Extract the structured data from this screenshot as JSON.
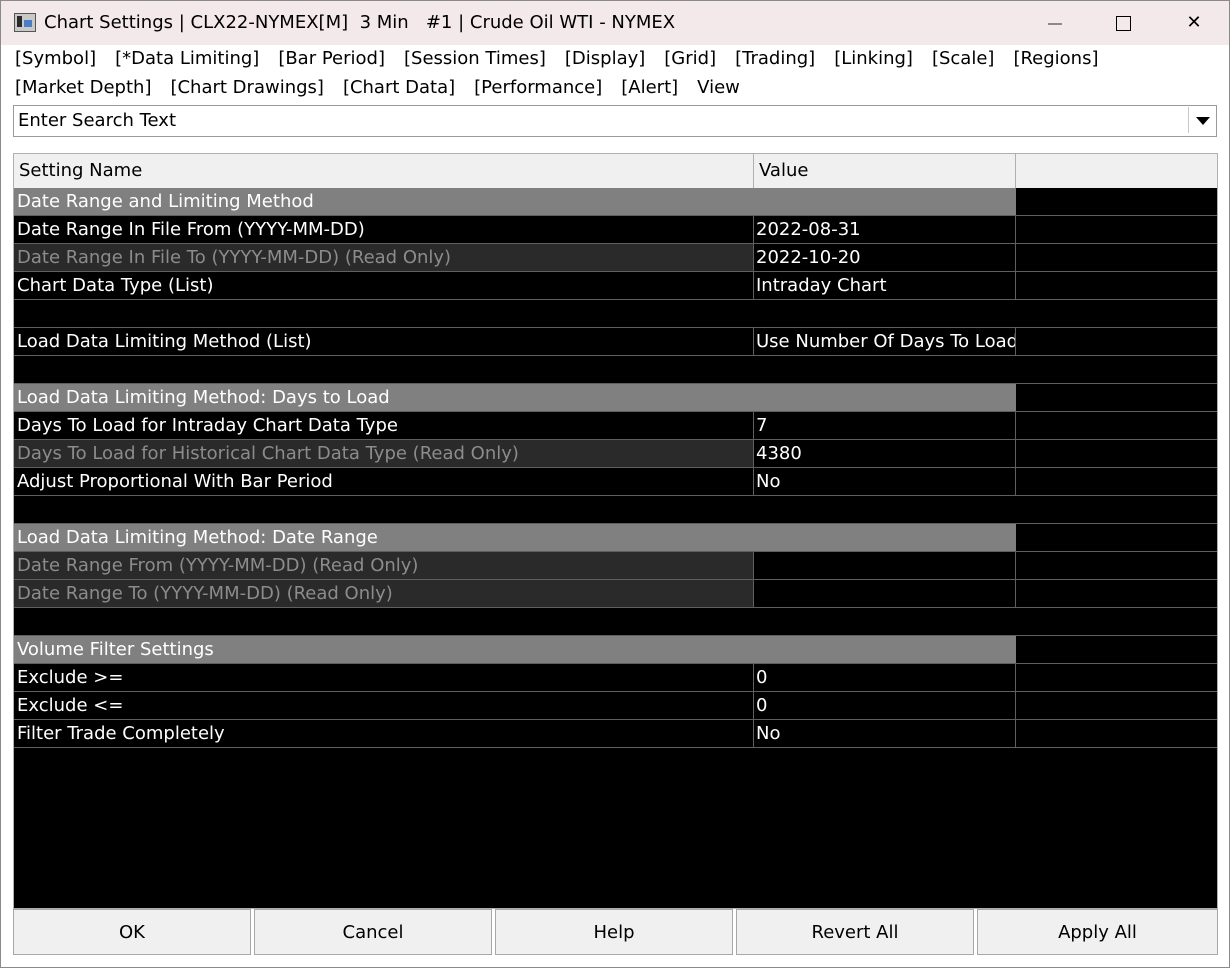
{
  "window": {
    "title": "Chart Settings | CLX22-NYMEX[M]  3 Min   #1 | Crude Oil WTI - NYMEX",
    "icons": [
      "app-icon",
      "minimize-icon",
      "maximize-icon",
      "close-icon"
    ]
  },
  "menu": {
    "row1": [
      "[Symbol]",
      "[*Data Limiting]",
      "[Bar Period]",
      "[Session Times]",
      "[Display]",
      "[Grid]",
      "[Trading]",
      "[Linking]",
      "[Scale]",
      "[Regions]"
    ],
    "row2": [
      "[Market Depth]",
      "[Chart Drawings]",
      "[Chart Data]",
      "[Performance]",
      "[Alert]",
      "View"
    ]
  },
  "search": {
    "placeholder": "Enter Search Text"
  },
  "grid": {
    "headers": {
      "name": "Setting Name",
      "value": "Value"
    },
    "rows": [
      {
        "kind": "section",
        "name": "Date Range and Limiting Method",
        "value": ""
      },
      {
        "kind": "normal",
        "name": "Date Range In File From (YYYY-MM-DD)",
        "value": "2022-08-31"
      },
      {
        "kind": "ro",
        "name": "Date Range In File To (YYYY-MM-DD) (Read Only)",
        "value": "2022-10-20"
      },
      {
        "kind": "normal",
        "name": "Chart Data Type (List)",
        "value": "Intraday Chart"
      },
      {
        "kind": "blank",
        "name": "",
        "value": ""
      },
      {
        "kind": "normal",
        "name": "Load Data Limiting Method (List)",
        "value": "Use Number Of Days To Load"
      },
      {
        "kind": "blank",
        "name": "",
        "value": ""
      },
      {
        "kind": "section",
        "name": "Load Data Limiting Method: Days to Load",
        "value": ""
      },
      {
        "kind": "normal",
        "name": "Days To Load for Intraday Chart Data Type",
        "value": "7"
      },
      {
        "kind": "ro",
        "name": "Days To Load for Historical Chart Data Type (Read Only)",
        "value": "4380"
      },
      {
        "kind": "normal",
        "name": "Adjust Proportional With Bar Period",
        "value": "No"
      },
      {
        "kind": "blank",
        "name": "",
        "value": ""
      },
      {
        "kind": "section",
        "name": "Load Data Limiting Method: Date Range",
        "value": ""
      },
      {
        "kind": "ro2",
        "name": "Date Range From (YYYY-MM-DD) (Read Only)",
        "value": ""
      },
      {
        "kind": "ro2",
        "name": "Date Range To (YYYY-MM-DD) (Read Only)",
        "value": ""
      },
      {
        "kind": "blank",
        "name": "",
        "value": ""
      },
      {
        "kind": "section",
        "name": "Volume Filter Settings",
        "value": ""
      },
      {
        "kind": "normal",
        "name": "Exclude >=",
        "value": "0"
      },
      {
        "kind": "normal",
        "name": "Exclude <=",
        "value": "0"
      },
      {
        "kind": "normal",
        "name": "Filter Trade Completely",
        "value": "No"
      }
    ]
  },
  "footer": {
    "buttons": [
      "OK",
      "Cancel",
      "Help",
      "Revert All",
      "Apply All"
    ]
  }
}
